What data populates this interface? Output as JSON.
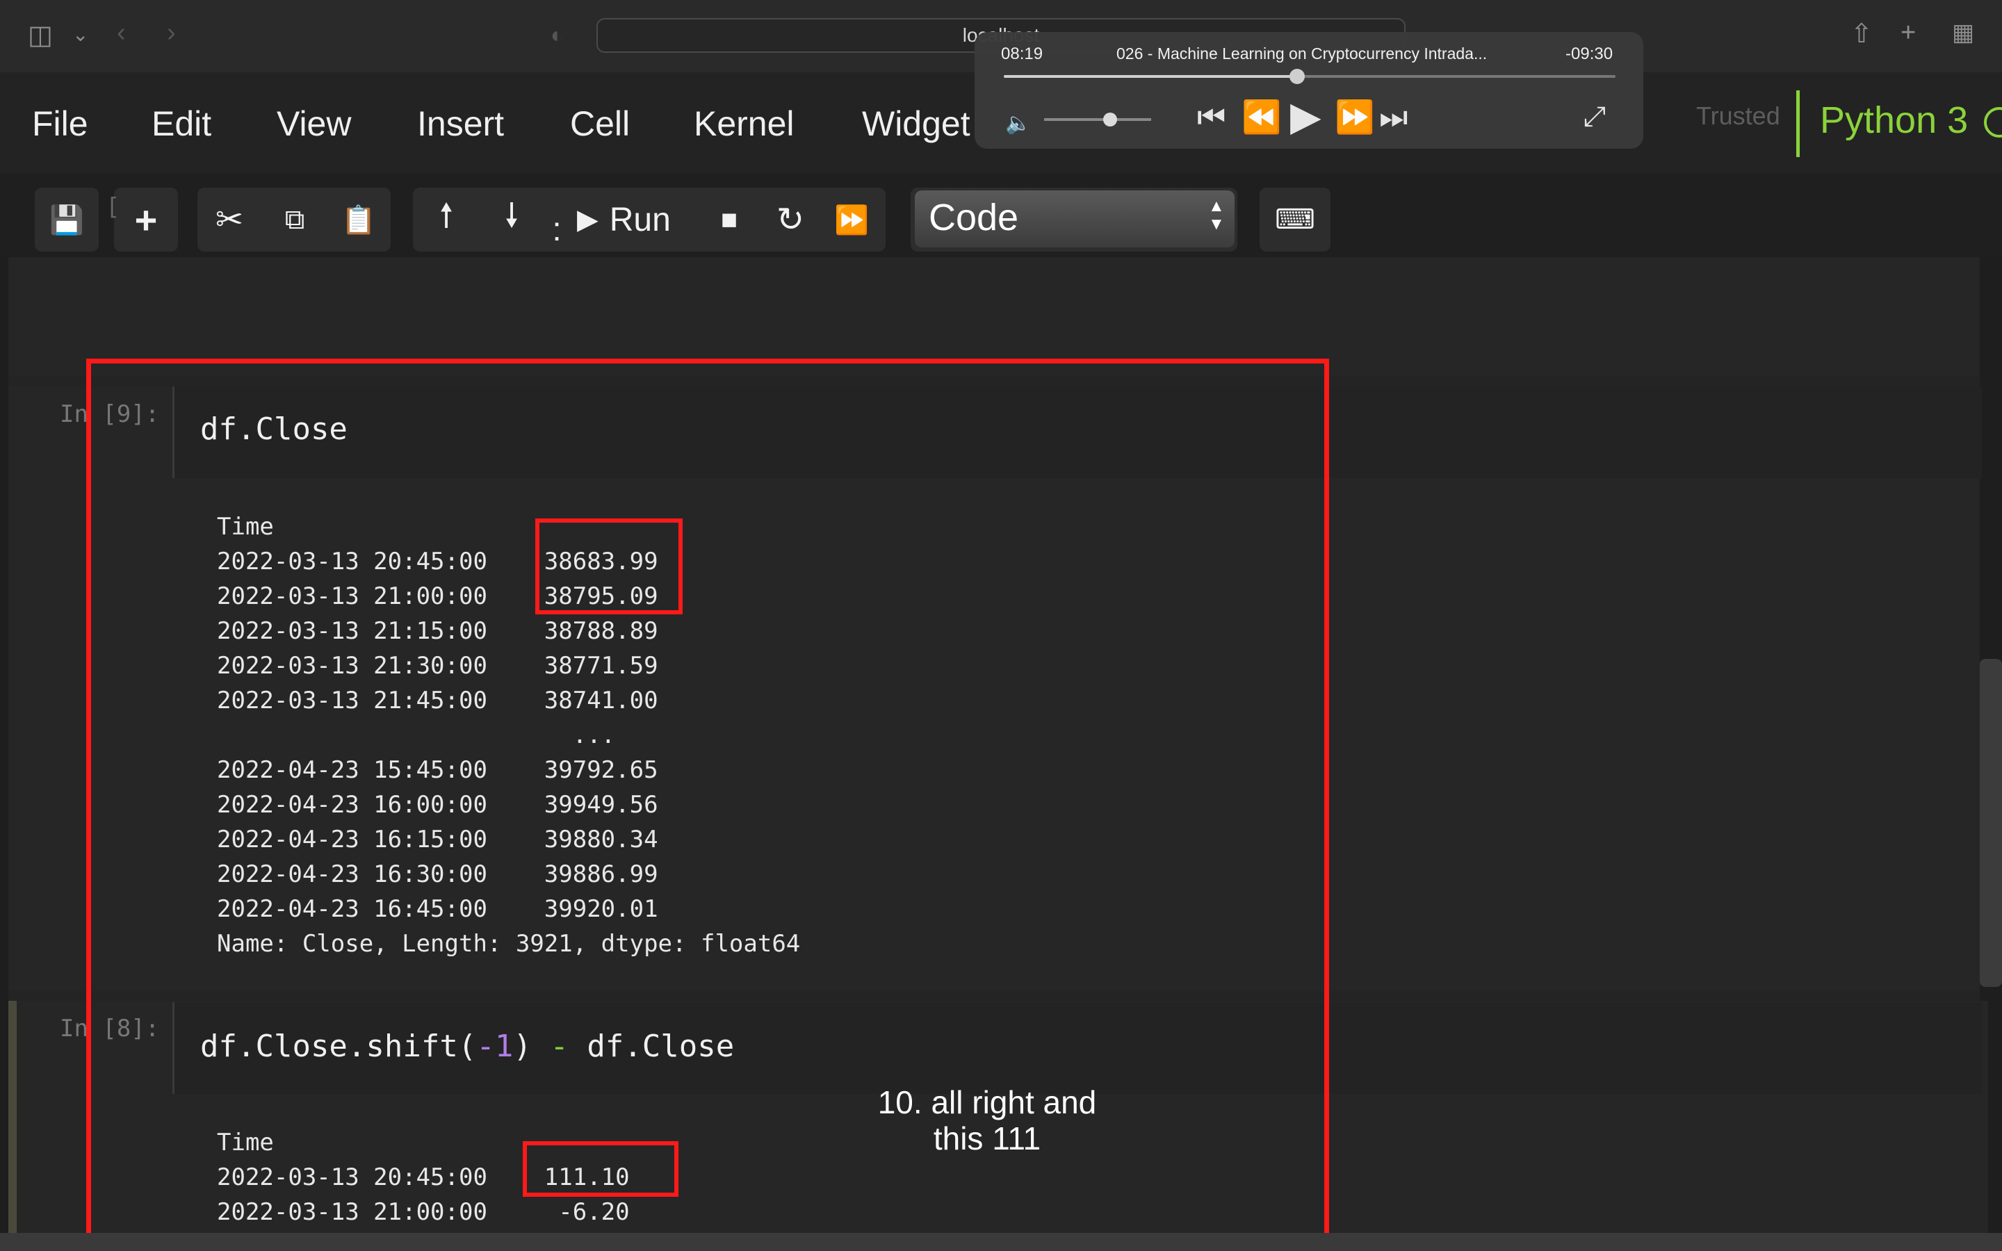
{
  "browser": {
    "url": "localhost",
    "icons": [
      "sidebar-icon",
      "chevron-down-icon",
      "back-icon",
      "forward-icon",
      "privacy-shield-icon",
      "share-icon",
      "new-tab-icon",
      "tab-overview-icon"
    ]
  },
  "player": {
    "elapsed": "08:19",
    "remaining": "-09:30",
    "title": "026 - Machine Learning on Cryptocurrency Intrada...",
    "progress_fraction": 0.48,
    "volume_fraction": 0.62
  },
  "menu": {
    "items": [
      "File",
      "Edit",
      "View",
      "Insert",
      "Cell",
      "Kernel",
      "Widget"
    ],
    "trusted": "Trusted",
    "kernel": "Python 3"
  },
  "toolbar": {
    "run_label": "Run",
    "separator": ":",
    "cell_type": "Code"
  },
  "cells": [
    {
      "prompt": "In [9]:",
      "code": "df.Close",
      "output": [
        "Time",
        "2022-03-13 20:45:00    38683.99",
        "2022-03-13 21:00:00    38795.09",
        "2022-03-13 21:15:00    38788.89",
        "2022-03-13 21:30:00    38771.59",
        "2022-03-13 21:45:00    38741.00",
        "                         ...",
        "2022-04-23 15:45:00    39792.65",
        "2022-04-23 16:00:00    39949.56",
        "2022-04-23 16:15:00    39880.34",
        "2022-04-23 16:30:00    39886.99",
        "2022-04-23 16:45:00    39920.01",
        "Name: Close, Length: 3921, dtype: float64"
      ]
    },
    {
      "prompt": "In [8]:",
      "code_parts": [
        "df.Close.shift(",
        "-1",
        ") ",
        "-",
        " df.Close"
      ],
      "output": [
        "Time",
        "2022-03-13 20:45:00    111.10",
        "2022-03-13 21:00:00     -6.20"
      ]
    }
  ],
  "caption": "10. all right and this 111",
  "colors": {
    "accent_green": "#8bd33a",
    "highlight_red": "#ff1a1a",
    "number_purple": "#b07ee8"
  }
}
